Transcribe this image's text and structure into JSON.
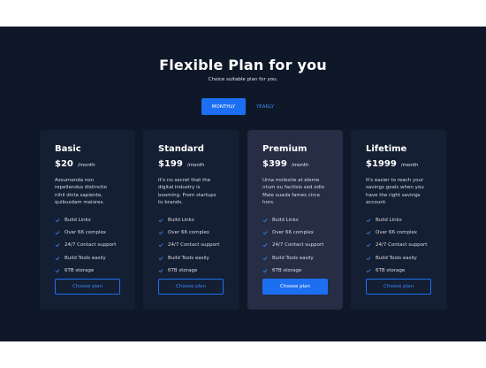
{
  "header": {
    "title": "Flexible Plan for you",
    "subtitle": "Choice suitable plan for you."
  },
  "toggle": {
    "monthly": "MONTHLY",
    "yearly": "YEARLY",
    "selected": "MONTHLY"
  },
  "accent_color": "#1d6ff2",
  "plans": [
    {
      "name": "Basic",
      "price": "$20",
      "period": "/month",
      "desc_lines": [
        "Assumenda non",
        "repellendus distinctio",
        "nihil dicta sapiente,",
        "quibusdam maiores."
      ],
      "features": [
        "Build Links",
        "Over 66 complex",
        "24/7 Contact support",
        "Build Tools easily",
        "6TB storage"
      ],
      "button": "Choose plan"
    },
    {
      "name": "Standard",
      "price": "$199",
      "period": "/month",
      "desc_lines": [
        "It's no secret that the",
        "digital industry is",
        "booming. From startups",
        "to brands."
      ],
      "features": [
        "Build Links",
        "Over 66 complex",
        "24/7 Contact support",
        "Build Tools easily",
        "6TB storage"
      ],
      "button": "Choose plan"
    },
    {
      "name": "Premium",
      "price": "$399",
      "period": "/month",
      "desc_lines": [
        "Urna molestie at eleme",
        "ntum eu facilisis sed odio",
        "Male suada fames circa",
        "hors."
      ],
      "features": [
        "Build Links",
        "Over 66 complex",
        "24/7 Contact support",
        "Build Tools easily",
        "6TB storage"
      ],
      "button": "Choose plan",
      "highlighted": true
    },
    {
      "name": "Lifetime",
      "price": "$1999",
      "period": "/month",
      "desc_lines": [
        "It's easier to reach your",
        "savings goals when you",
        "have the right savings",
        "account."
      ],
      "features": [
        "Build Links",
        "Over 66 complex",
        "24/7 Contact support",
        "Build Tools easily",
        "6TB storage"
      ],
      "button": "Choose plan"
    }
  ]
}
